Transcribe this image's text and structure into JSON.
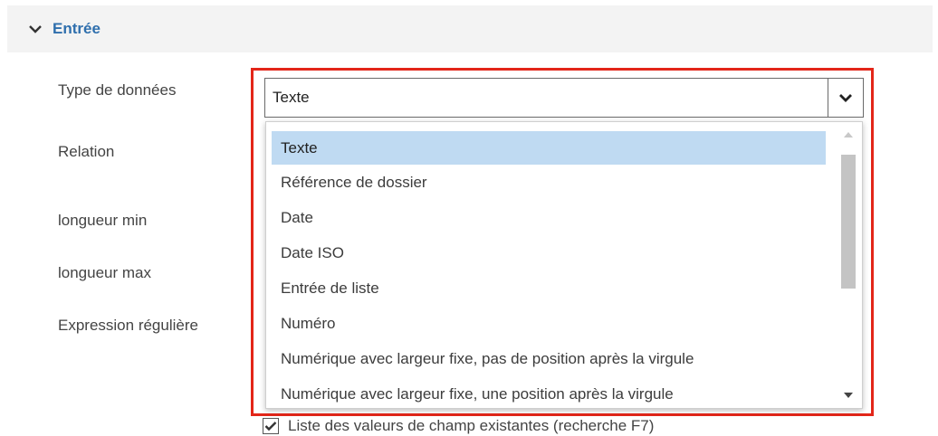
{
  "section": {
    "title": "Entrée",
    "expanded": true
  },
  "labels": {
    "data_type": "Type de données",
    "relation": "Relation",
    "min_length": "longueur min",
    "max_length": "longueur max",
    "regex": "Expression régulière"
  },
  "select": {
    "value": "Texte",
    "options": [
      "Texte",
      "Référence de dossier",
      "Date",
      "Date ISO",
      "Entrée de liste",
      "Numéro",
      "Numérique avec largeur fixe, pas de position après la virgule",
      "Numérique avec largeur fixe, une position après la virgule"
    ],
    "selected_index": 0
  },
  "checkbox": {
    "label": "Liste des valeurs de champ existantes (recherche F7)",
    "checked": true
  },
  "colors": {
    "accent": "#2f6fad",
    "highlight_border": "#e32619",
    "selected_bg": "#bfdaf2"
  }
}
